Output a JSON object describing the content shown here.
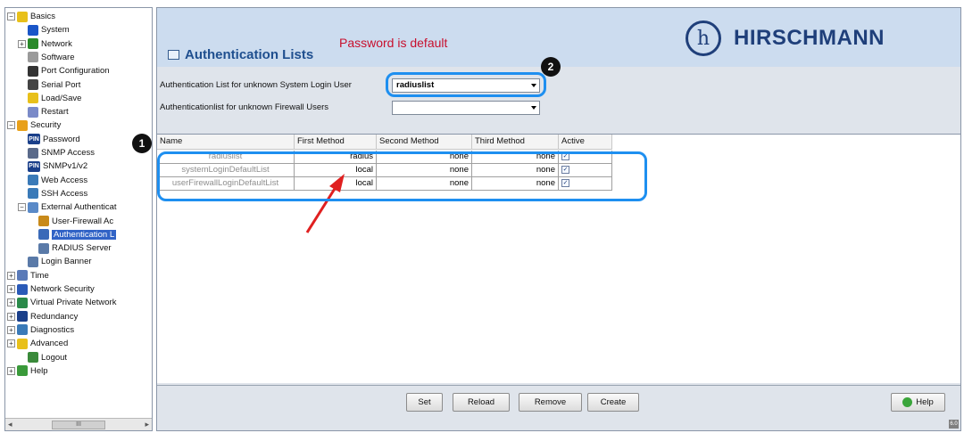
{
  "tree": {
    "nodes": [
      {
        "label": "Basics",
        "expander": "−",
        "icon_color": "#e8c01a"
      },
      {
        "label": "System",
        "expander": "",
        "icon_color": "#1a56c8"
      },
      {
        "label": "Network",
        "expander": "+",
        "icon_color": "#2a8a2a"
      },
      {
        "label": "Software",
        "expander": "",
        "icon_color": "#9a9a9a"
      },
      {
        "label": "Port Configuration",
        "expander": "",
        "icon_color": "#333333"
      },
      {
        "label": "Serial Port",
        "expander": "",
        "icon_color": "#444444"
      },
      {
        "label": "Load/Save",
        "expander": "",
        "icon_color": "#e8c01a"
      },
      {
        "label": "Restart",
        "expander": "",
        "icon_color": "#7a8ac8"
      },
      {
        "label": "Security",
        "expander": "−",
        "icon_color": "#e8a01a"
      },
      {
        "label": "Password",
        "expander": "",
        "icon_color": "#1a3f8a"
      },
      {
        "label": "SNMP Access",
        "expander": "",
        "icon_color": "#5a6a8a"
      },
      {
        "label": "SNMPv1/v2",
        "expander": "",
        "icon_color": "#1a3f8a"
      },
      {
        "label": "Web Access",
        "expander": "",
        "icon_color": "#3a7ab8"
      },
      {
        "label": "SSH Access",
        "expander": "",
        "icon_color": "#3a7ab8"
      },
      {
        "label": "External Authenticat",
        "expander": "−",
        "icon_color": "#5a8ac8"
      },
      {
        "label": "User-Firewall Ac",
        "expander": "",
        "icon_color": "#c88a1a"
      },
      {
        "label": "Authentication L",
        "expander": "",
        "icon_color": "#3a6ab8"
      },
      {
        "label": "RADIUS Server",
        "expander": "",
        "icon_color": "#5a7aa8"
      },
      {
        "label": "Login Banner",
        "expander": "",
        "icon_color": "#5a7aa8"
      },
      {
        "label": "Time",
        "expander": "+",
        "icon_color": "#5a7ab8"
      },
      {
        "label": "Network Security",
        "expander": "+",
        "icon_color": "#2a5ab8"
      },
      {
        "label": "Virtual Private Network",
        "expander": "+",
        "icon_color": "#2a8a4a"
      },
      {
        "label": "Redundancy",
        "expander": "+",
        "icon_color": "#1a3f8a"
      },
      {
        "label": "Diagnostics",
        "expander": "+",
        "icon_color": "#3a7ab8"
      },
      {
        "label": "Advanced",
        "expander": "+",
        "icon_color": "#e8c01a"
      },
      {
        "label": "Logout",
        "expander": "",
        "icon_color": "#3a8a3a"
      },
      {
        "label": "Help",
        "expander": "+",
        "icon_color": "#3a9a3a"
      }
    ],
    "pin_text": "PIN",
    "scroll_thumb": "III"
  },
  "header": {
    "page_title": "Authentication Lists",
    "warning": "Password is default",
    "logo_symbol": "h",
    "logo_text": "HIRSCHMANN"
  },
  "form": {
    "system_login_label": "Authentication List for unknown System Login User",
    "system_login_value": "radiuslist",
    "firewall_label": "Authenticationlist for unknown Firewall Users",
    "firewall_value": ""
  },
  "annotations": {
    "badge1": "1",
    "badge2": "2",
    "highlight_color": "#1e8ff0",
    "arrow_color": "#e02020"
  },
  "table": {
    "columns": [
      "Name",
      "First Method",
      "Second Method",
      "Third Method",
      "Active"
    ],
    "rows": [
      {
        "name": "radiuslist",
        "first": "radius",
        "second": "none",
        "third": "none",
        "active": "✓"
      },
      {
        "name": "systemLoginDefaultList",
        "first": "local",
        "second": "none",
        "third": "none",
        "active": "✓"
      },
      {
        "name": "userFirewallLoginDefaultList",
        "first": "local",
        "second": "none",
        "third": "none",
        "active": "✓"
      }
    ]
  },
  "buttons": {
    "set": "Set",
    "reload": "Reload",
    "remove": "Remove",
    "create": "Create",
    "help": "Help"
  },
  "status": {
    "corner": "6.0"
  }
}
